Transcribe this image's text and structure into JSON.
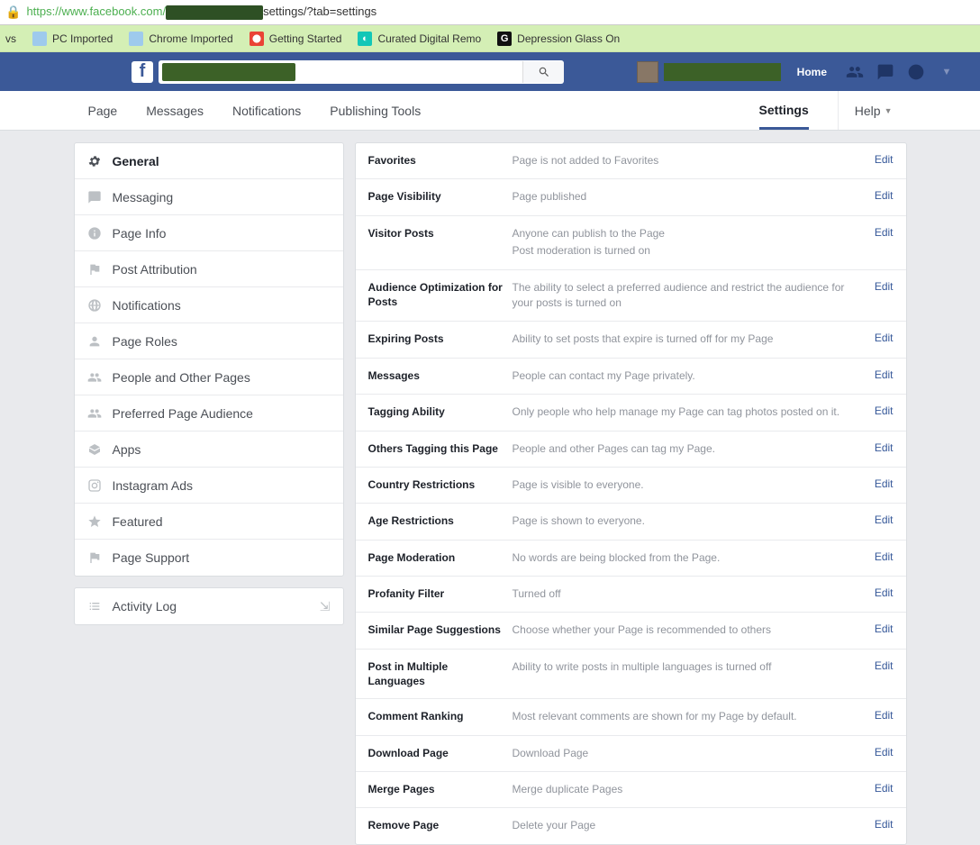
{
  "url": {
    "prefix": "https://www.facebook.com/",
    "suffix": "settings/?tab=settings"
  },
  "bookmarks": [
    {
      "label": "vs",
      "icon": "text"
    },
    {
      "label": "PC Imported",
      "icon": "folder"
    },
    {
      "label": "Chrome Imported",
      "icon": "folder"
    },
    {
      "label": "Getting Started",
      "icon": "gs"
    },
    {
      "label": "Curated Digital Remo",
      "icon": "teal"
    },
    {
      "label": "Depression Glass On",
      "icon": "g"
    }
  ],
  "header": {
    "home": "Home"
  },
  "tabs": {
    "items": [
      "Page",
      "Messages",
      "Notifications",
      "Publishing Tools"
    ],
    "settings": "Settings",
    "help": "Help",
    "active": "Settings"
  },
  "sidebar": {
    "group1": [
      {
        "id": "general",
        "label": "General",
        "icon": "gear",
        "active": true
      },
      {
        "id": "messaging",
        "label": "Messaging",
        "icon": "chat"
      },
      {
        "id": "page-info",
        "label": "Page Info",
        "icon": "info"
      },
      {
        "id": "post-attribution",
        "label": "Post Attribution",
        "icon": "flag"
      },
      {
        "id": "notifications",
        "label": "Notifications",
        "icon": "globe"
      },
      {
        "id": "page-roles",
        "label": "Page Roles",
        "icon": "person"
      },
      {
        "id": "people-pages",
        "label": "People and Other Pages",
        "icon": "people"
      },
      {
        "id": "preferred-audience",
        "label": "Preferred Page Audience",
        "icon": "people"
      },
      {
        "id": "apps",
        "label": "Apps",
        "icon": "box"
      },
      {
        "id": "instagram",
        "label": "Instagram Ads",
        "icon": "instagram"
      },
      {
        "id": "featured",
        "label": "Featured",
        "icon": "star"
      },
      {
        "id": "page-support",
        "label": "Page Support",
        "icon": "flag2"
      }
    ],
    "group2": [
      {
        "id": "activity-log",
        "label": "Activity Log",
        "icon": "list",
        "export": true
      }
    ]
  },
  "settings_rows": [
    {
      "label": "Favorites",
      "desc": [
        "Page is not added to Favorites"
      ],
      "edit": "Edit"
    },
    {
      "label": "Page Visibility",
      "desc": [
        "Page published"
      ],
      "edit": "Edit"
    },
    {
      "label": "Visitor Posts",
      "desc": [
        "Anyone can publish to the Page",
        "Post moderation is turned on"
      ],
      "edit": "Edit"
    },
    {
      "label": "Audience Optimization for Posts",
      "desc": [
        "The ability to select a preferred audience and restrict the audience for your posts is turned on"
      ],
      "edit": "Edit"
    },
    {
      "label": "Expiring Posts",
      "desc": [
        "Ability to set posts that expire is turned off for my Page"
      ],
      "edit": "Edit"
    },
    {
      "label": "Messages",
      "desc": [
        "People can contact my Page privately."
      ],
      "edit": "Edit"
    },
    {
      "label": "Tagging Ability",
      "desc": [
        "Only people who help manage my Page can tag photos posted on it."
      ],
      "edit": "Edit"
    },
    {
      "label": "Others Tagging this Page",
      "desc": [
        "People and other Pages can tag my Page."
      ],
      "edit": "Edit"
    },
    {
      "label": "Country Restrictions",
      "desc": [
        "Page is visible to everyone."
      ],
      "edit": "Edit"
    },
    {
      "label": "Age Restrictions",
      "desc": [
        "Page is shown to everyone."
      ],
      "edit": "Edit"
    },
    {
      "label": "Page Moderation",
      "desc": [
        "No words are being blocked from the Page."
      ],
      "edit": "Edit"
    },
    {
      "label": "Profanity Filter",
      "desc": [
        "Turned off"
      ],
      "edit": "Edit"
    },
    {
      "label": "Similar Page Suggestions",
      "desc": [
        "Choose whether your Page is recommended to others"
      ],
      "edit": "Edit"
    },
    {
      "label": "Post in Multiple Languages",
      "desc": [
        "Ability to write posts in multiple languages is turned off"
      ],
      "edit": "Edit"
    },
    {
      "label": "Comment Ranking",
      "desc": [
        "Most relevant comments are shown for my Page by default."
      ],
      "edit": "Edit"
    },
    {
      "label": "Download Page",
      "desc": [
        "Download Page"
      ],
      "edit": "Edit"
    },
    {
      "label": "Merge Pages",
      "desc": [
        "Merge duplicate Pages"
      ],
      "edit": "Edit"
    },
    {
      "label": "Remove Page",
      "desc": [
        "Delete your Page"
      ],
      "edit": "Edit"
    }
  ]
}
